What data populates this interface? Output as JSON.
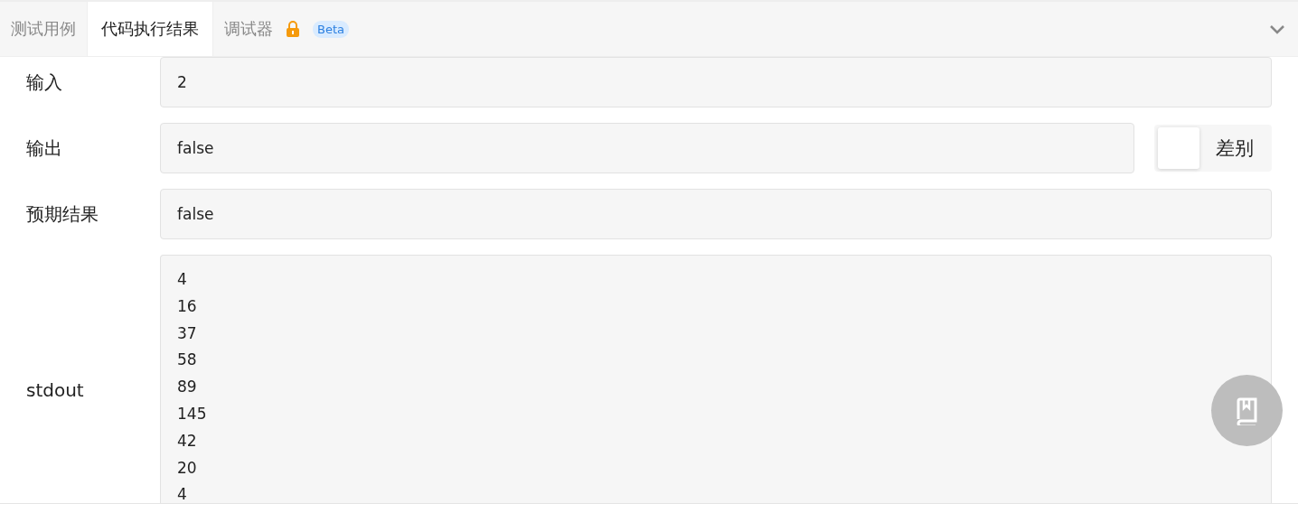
{
  "tabs": [
    {
      "label": "测试用例",
      "selected": false
    },
    {
      "label": "代码执行结果",
      "selected": true
    },
    {
      "label": "调试器",
      "selected": false,
      "locked": true,
      "badge": "Beta"
    }
  ],
  "rows": [
    {
      "label": "输入",
      "value": "2"
    },
    {
      "label": "输出",
      "value": "false",
      "diff": {
        "label": "差别",
        "on": false
      }
    },
    {
      "label": "预期结果",
      "value": "false"
    },
    {
      "label": "stdout",
      "lines": [
        "4",
        "16",
        "37",
        "58",
        "89",
        "145",
        "42",
        "20",
        "4"
      ]
    }
  ]
}
